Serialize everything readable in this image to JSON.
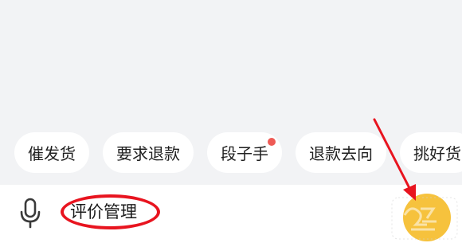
{
  "quick_replies": [
    {
      "label": "催发货",
      "has_dot": false
    },
    {
      "label": "要求退款",
      "has_dot": false
    },
    {
      "label": "段子手",
      "has_dot": true
    },
    {
      "label": "退款去向",
      "has_dot": false
    },
    {
      "label": "挑好货",
      "has_dot": false
    }
  ],
  "input": {
    "value": "评价管理"
  },
  "icons": {
    "microphone": "microphone-icon",
    "send": "send-button"
  },
  "colors": {
    "accent_yellow": "#f6c23d",
    "annotation_red": "#e8141f",
    "dot_red": "#ee5a55"
  }
}
